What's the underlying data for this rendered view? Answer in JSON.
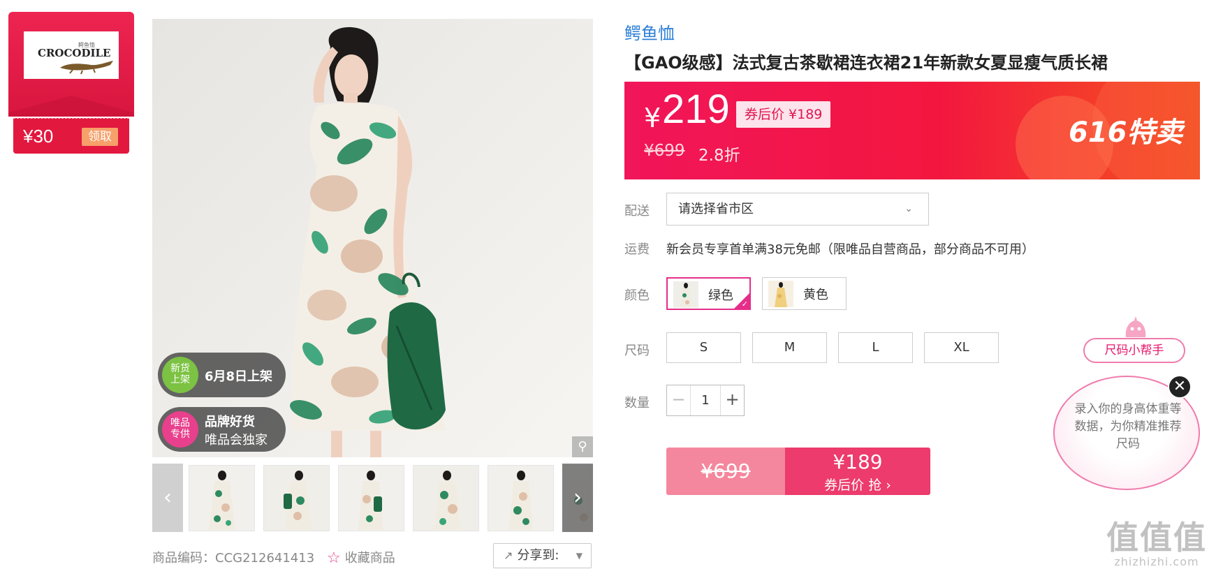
{
  "brand_card": {
    "logo_cn": "鳄鱼恤",
    "logo_text": "CROCODILE",
    "coupon_amount": "¥30",
    "coupon_button": "领取"
  },
  "main_image": {
    "badges": [
      {
        "circle": "新货\n上架",
        "circle_color": "#7cc243",
        "line1": "6月8日上架",
        "line2": ""
      },
      {
        "circle": "唯品\n专供",
        "circle_color": "#e8408c",
        "line1": "品牌好货",
        "line2": "唯品会独家"
      }
    ],
    "zoom_icon": "magnifier-icon"
  },
  "thumbnails": {
    "count": 6,
    "prev_icon": "chevron-left-icon",
    "next_icon": "chevron-right-icon"
  },
  "meta": {
    "sku": "商品编码：CCG212641413",
    "favorite": "收藏商品",
    "share": "分享到:"
  },
  "product": {
    "brand": "鳄鱼恤",
    "title": "【GAO级感】法式复古茶歇裙连衣裙21年新款女夏显瘦气质长裙"
  },
  "price": {
    "currency": "¥",
    "current": "219",
    "coupon_price": "券后价 ¥189",
    "original": "¥699",
    "discount": "2.8折",
    "promo": "616特卖"
  },
  "delivery": {
    "label": "配送",
    "placeholder": "请选择省市区"
  },
  "shipping": {
    "label": "运费",
    "text": "新会员专享首单满38元免邮（限唯品自营商品，部分商品不可用）"
  },
  "colors": {
    "label": "颜色",
    "options": [
      {
        "name": "绿色",
        "selected": true
      },
      {
        "name": "黄色",
        "selected": false
      }
    ]
  },
  "sizes": {
    "label": "尺码",
    "options": [
      "S",
      "M",
      "L",
      "XL"
    ]
  },
  "quantity": {
    "label": "数量",
    "value": "1",
    "minus": "−",
    "plus": "+"
  },
  "buy_button": {
    "original": "¥699",
    "price": "¥189",
    "cta": "券后价 抢 ›"
  },
  "size_helper": {
    "title": "尺码小帮手",
    "text": "录入你的身高体重等数据，为你精准推荐尺码",
    "close": "✕"
  },
  "watermark": {
    "line1": "值值值",
    "line2": "zhizhizhi.com"
  },
  "colors_theme": {
    "accent_pink": "#e52e8a",
    "price_red": "#f3173f",
    "brand_blue": "#2d7fd8"
  }
}
